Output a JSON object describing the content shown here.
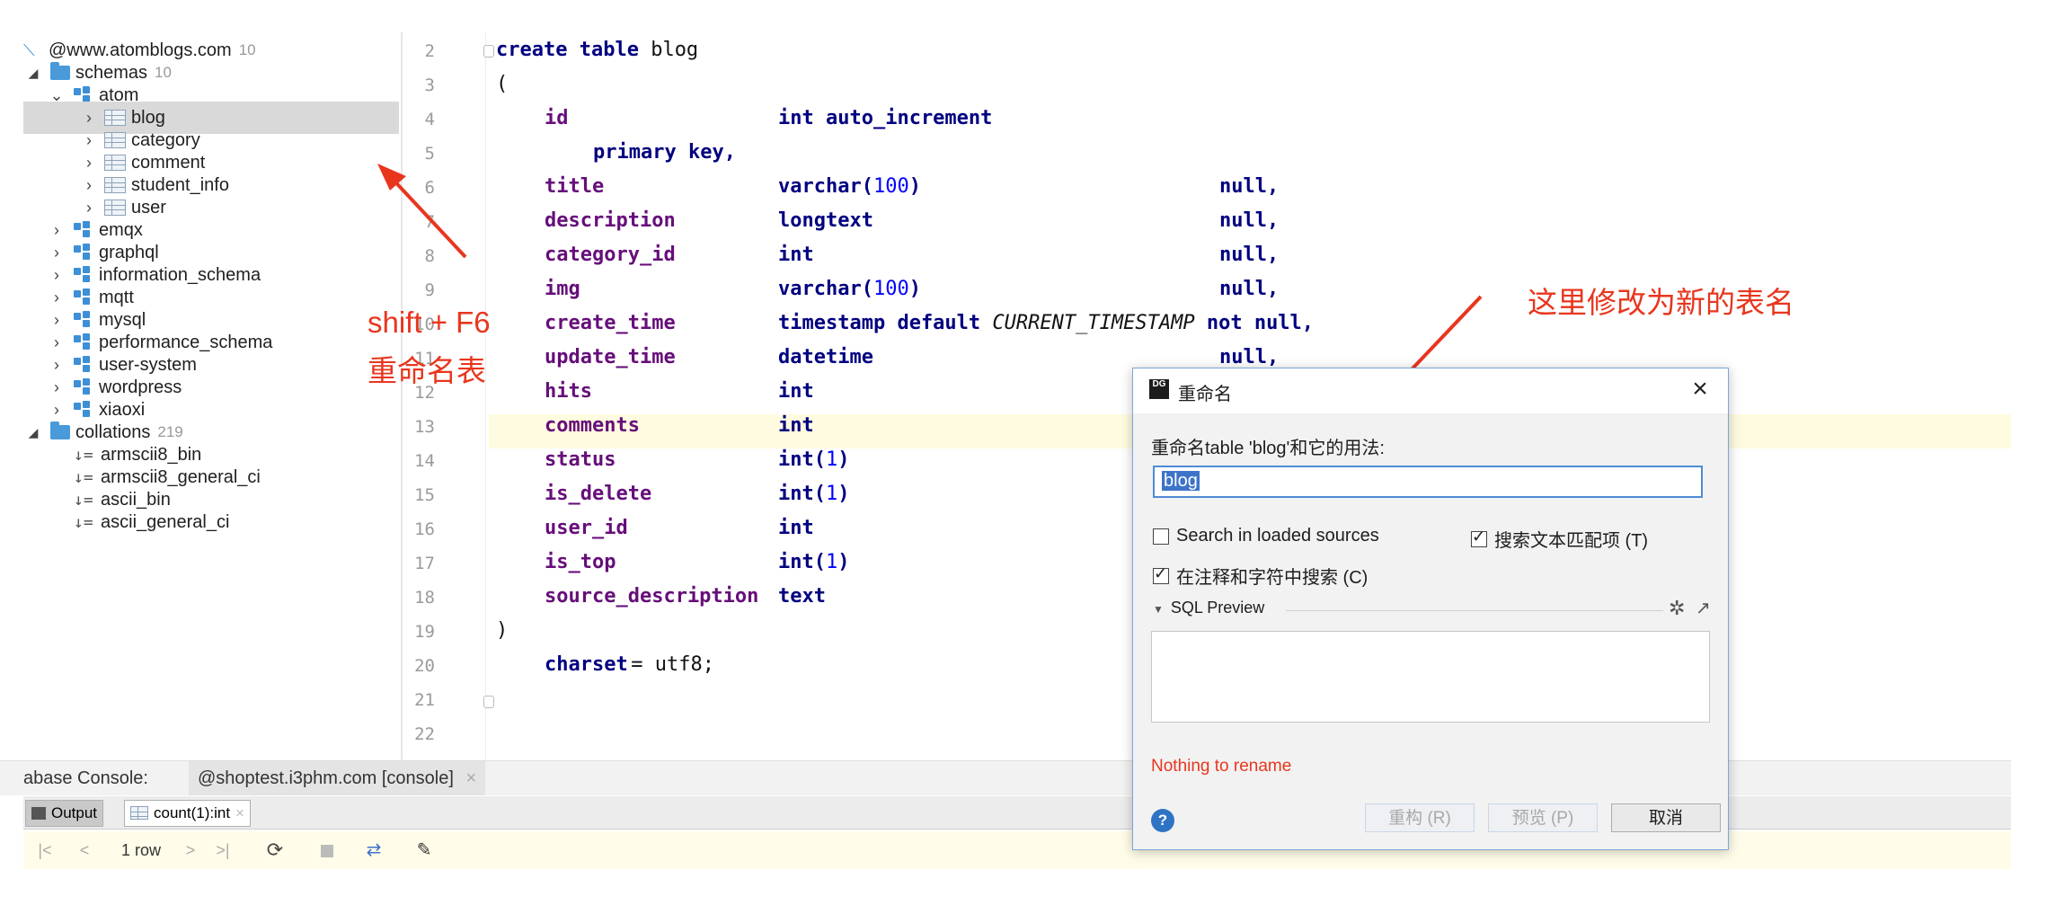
{
  "sidebar": {
    "items": [
      {
        "label": "@www.atomblogs.com",
        "count": "10",
        "icon": "db-connection-icon"
      },
      {
        "label": "schemas",
        "count": "10",
        "icon": "folder-icon"
      },
      {
        "label": "atom",
        "icon": "schema-icon"
      },
      {
        "label": "blog",
        "icon": "table-icon"
      },
      {
        "label": "category",
        "icon": "table-icon"
      },
      {
        "label": "comment",
        "icon": "table-icon"
      },
      {
        "label": "student_info",
        "icon": "table-icon"
      },
      {
        "label": "user",
        "icon": "table-icon"
      },
      {
        "label": "emqx",
        "icon": "schema-icon"
      },
      {
        "label": "graphql",
        "icon": "schema-icon"
      },
      {
        "label": "information_schema",
        "icon": "schema-icon"
      },
      {
        "label": "mqtt",
        "icon": "schema-icon"
      },
      {
        "label": "mysql",
        "icon": "schema-icon"
      },
      {
        "label": "performance_schema",
        "icon": "schema-icon"
      },
      {
        "label": "user-system",
        "icon": "schema-icon"
      },
      {
        "label": "wordpress",
        "icon": "schema-icon"
      },
      {
        "label": "xiaoxi",
        "icon": "schema-icon"
      },
      {
        "label": "collations",
        "count": "219",
        "icon": "folder-icon"
      },
      {
        "label": "armscii8_bin",
        "icon": "collation-icon"
      },
      {
        "label": "armscii8_general_ci",
        "icon": "collation-icon"
      },
      {
        "label": "ascii_bin",
        "icon": "collation-icon"
      },
      {
        "label": "ascii_general_ci",
        "icon": "collation-icon"
      }
    ]
  },
  "editor": {
    "line_numbers": [
      "2",
      "3",
      "4",
      "5",
      "6",
      "7",
      "8",
      "9",
      "10",
      "11",
      "12",
      "13",
      "14",
      "15",
      "16",
      "17",
      "18",
      "19",
      "20",
      "21",
      "22"
    ],
    "code": {
      "l2": [
        "create table",
        " blog"
      ],
      "l3": "(",
      "l4": [
        "id",
        "int auto_increment"
      ],
      "l5": "primary key,",
      "l6": [
        "title",
        "varchar(",
        "100",
        ")",
        "null,"
      ],
      "l7": [
        "description",
        "longtext",
        "null,"
      ],
      "l8": [
        "category_id",
        "int",
        "null,"
      ],
      "l9": [
        "img",
        "varchar(",
        "100",
        ")",
        "null,"
      ],
      "l10": [
        "create_time",
        "timestamp default ",
        "CURRENT_TIMESTAMP",
        " not null,"
      ],
      "l11": [
        "update_time",
        "datetime",
        "null,"
      ],
      "l12": [
        "hits",
        "int"
      ],
      "l13": [
        "comments",
        "int"
      ],
      "l14": [
        "status",
        "int(",
        "1",
        ")"
      ],
      "l15": [
        "is_delete",
        "int(",
        "1",
        ")"
      ],
      "l16": [
        "user_id",
        "int"
      ],
      "l17": [
        "is_top",
        "int(",
        "1",
        ")"
      ],
      "l18": [
        "source_description",
        "text"
      ],
      "l19": ")",
      "l20": [
        "charset",
        " = utf8;"
      ]
    }
  },
  "bottom": {
    "console_label": "abase Console:",
    "console_tab": "@shoptest.i3phm.com [console]",
    "output_tab": "Output",
    "result_tab": "count(1):int",
    "row_count": "1 row"
  },
  "annotations": {
    "left_line1": "shift + F6",
    "left_line2": "重命名表",
    "right": "这里修改为新的表名"
  },
  "dialog": {
    "title": "重命名",
    "logo_text": "DG",
    "prompt": "重命名table 'blog'和它的用法:",
    "input_value": "blog",
    "cb_loaded_sources": "Search in loaded sources",
    "cb_search_text": "搜索文本匹配项 (T)",
    "cb_comments": "在注释和字符中搜索 (C)",
    "sql_preview_label": "SQL Preview",
    "error_text": "Nothing to rename",
    "btn_refactor": "重构 (R)",
    "btn_preview": "预览 (P)",
    "btn_cancel": "取消",
    "help": "?",
    "checkbox_states": {
      "loaded_sources": false,
      "search_text": true,
      "comments": true
    }
  },
  "colors": {
    "annotation": "#e8361e",
    "selection": "#d9d9d9",
    "dialog_border": "#7aa7d8",
    "input_highlight": "#3d73c9",
    "error_text": "#e8361e"
  }
}
